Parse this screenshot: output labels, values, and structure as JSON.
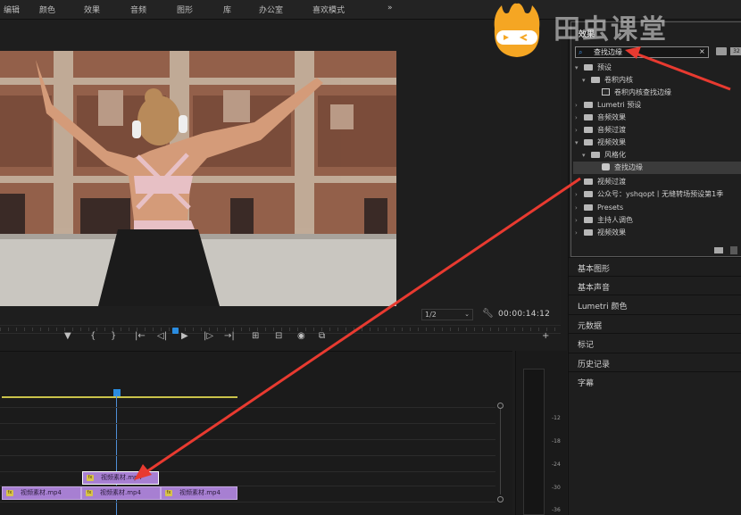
{
  "menu": [
    "编辑",
    "颜色",
    "效果",
    "音频",
    "图形",
    "库",
    "办公室",
    "喜欢模式",
    "»"
  ],
  "program": {
    "zoom": "1/2",
    "timecode": "00:00:14:12"
  },
  "transport": [
    "▼",
    "{",
    "}",
    "|←",
    "◁|",
    "▶",
    "|▷",
    "→|",
    "⊞",
    "⊟",
    "◉",
    "⧉",
    "+"
  ],
  "timeline": {
    "clips_v2": [
      "视频素材.mp4"
    ],
    "clips_v1": [
      "视频素材.mp4",
      "视频素材.mp4",
      "视频素材.mp4"
    ],
    "fx_badge": "fx"
  },
  "meter": {
    "labels": [
      "-12",
      "-18",
      "-24",
      "-30",
      "-36"
    ]
  },
  "effects_panel": {
    "title": "效果",
    "search_value": "查找边缘",
    "clear_icon": "×",
    "badge": "32",
    "tree": [
      {
        "label": "预设",
        "caret": "▾",
        "icon": "folder"
      },
      {
        "label": "卷积内核",
        "caret": "▾",
        "icon": "folder"
      },
      {
        "label": "卷积内核查找边缘",
        "caret": "",
        "icon": "preset"
      },
      {
        "label": "Lumetri 预设",
        "caret": "›",
        "icon": "folder"
      },
      {
        "label": "音频效果",
        "caret": "›",
        "icon": "folder"
      },
      {
        "label": "音频过渡",
        "caret": "›",
        "icon": "folder"
      },
      {
        "label": "视频效果",
        "caret": "▾",
        "icon": "folder"
      },
      {
        "label": "风格化",
        "caret": "▾",
        "icon": "folder"
      },
      {
        "label": "查找边缘",
        "caret": "",
        "icon": "fx"
      },
      {
        "label": "视频过渡",
        "caret": "›",
        "icon": "folder"
      },
      {
        "label": "公众号：yshqopt丨无缝转场预设第1季",
        "caret": "›",
        "icon": "folder"
      },
      {
        "label": "Presets",
        "caret": "›",
        "icon": "folder"
      },
      {
        "label": "主持人调色",
        "caret": "›",
        "icon": "folder"
      },
      {
        "label": "视频效果",
        "caret": "›",
        "icon": "folder"
      }
    ]
  },
  "side_panels": [
    "基本图形",
    "基本声音",
    "Lumetri 颜色",
    "元数据",
    "标记",
    "历史记录",
    "字幕"
  ],
  "watermark": "田虫课堂",
  "colors": {
    "accent_blue": "#2a8ce0",
    "clip_purple": "#a77fd2",
    "arrow_red": "#e83a30",
    "work_area": "#c9c24a"
  }
}
